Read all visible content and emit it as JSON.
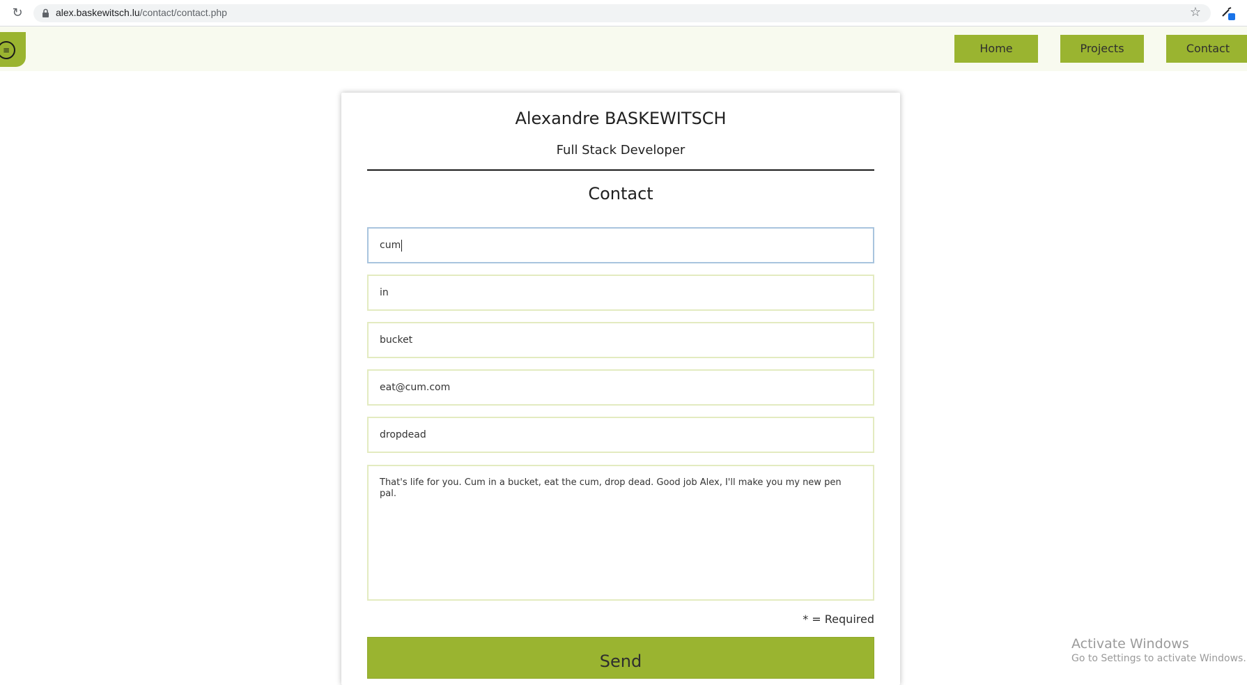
{
  "browser": {
    "url_domain": "alex.baskewitsch.lu",
    "url_path": "/contact/contact.php"
  },
  "nav": {
    "items": [
      {
        "label": "Home"
      },
      {
        "label": "Projects"
      },
      {
        "label": "Contact"
      }
    ]
  },
  "card": {
    "name": "Alexandre BASKEWITSCH",
    "role": "Full Stack Developer",
    "heading": "Contact"
  },
  "form": {
    "fields": [
      {
        "value": "cum"
      },
      {
        "value": "in"
      },
      {
        "value": "bucket"
      },
      {
        "value": "eat@cum.com"
      },
      {
        "value": "dropdead"
      }
    ],
    "message": "That's life for you. Cum in a bucket, eat the cum, drop dead. Good job Alex, I'll make you my new pen pal.",
    "required_note": "* = Required",
    "send_label": "Send"
  },
  "watermark": {
    "title": "Activate Windows",
    "subtitle": "Go to Settings to activate Windows."
  },
  "colors": {
    "accent": "#9ab430",
    "nav_background": "#f8faef",
    "field_border": "#e3ebc0",
    "focus_border": "#a8c4de"
  }
}
